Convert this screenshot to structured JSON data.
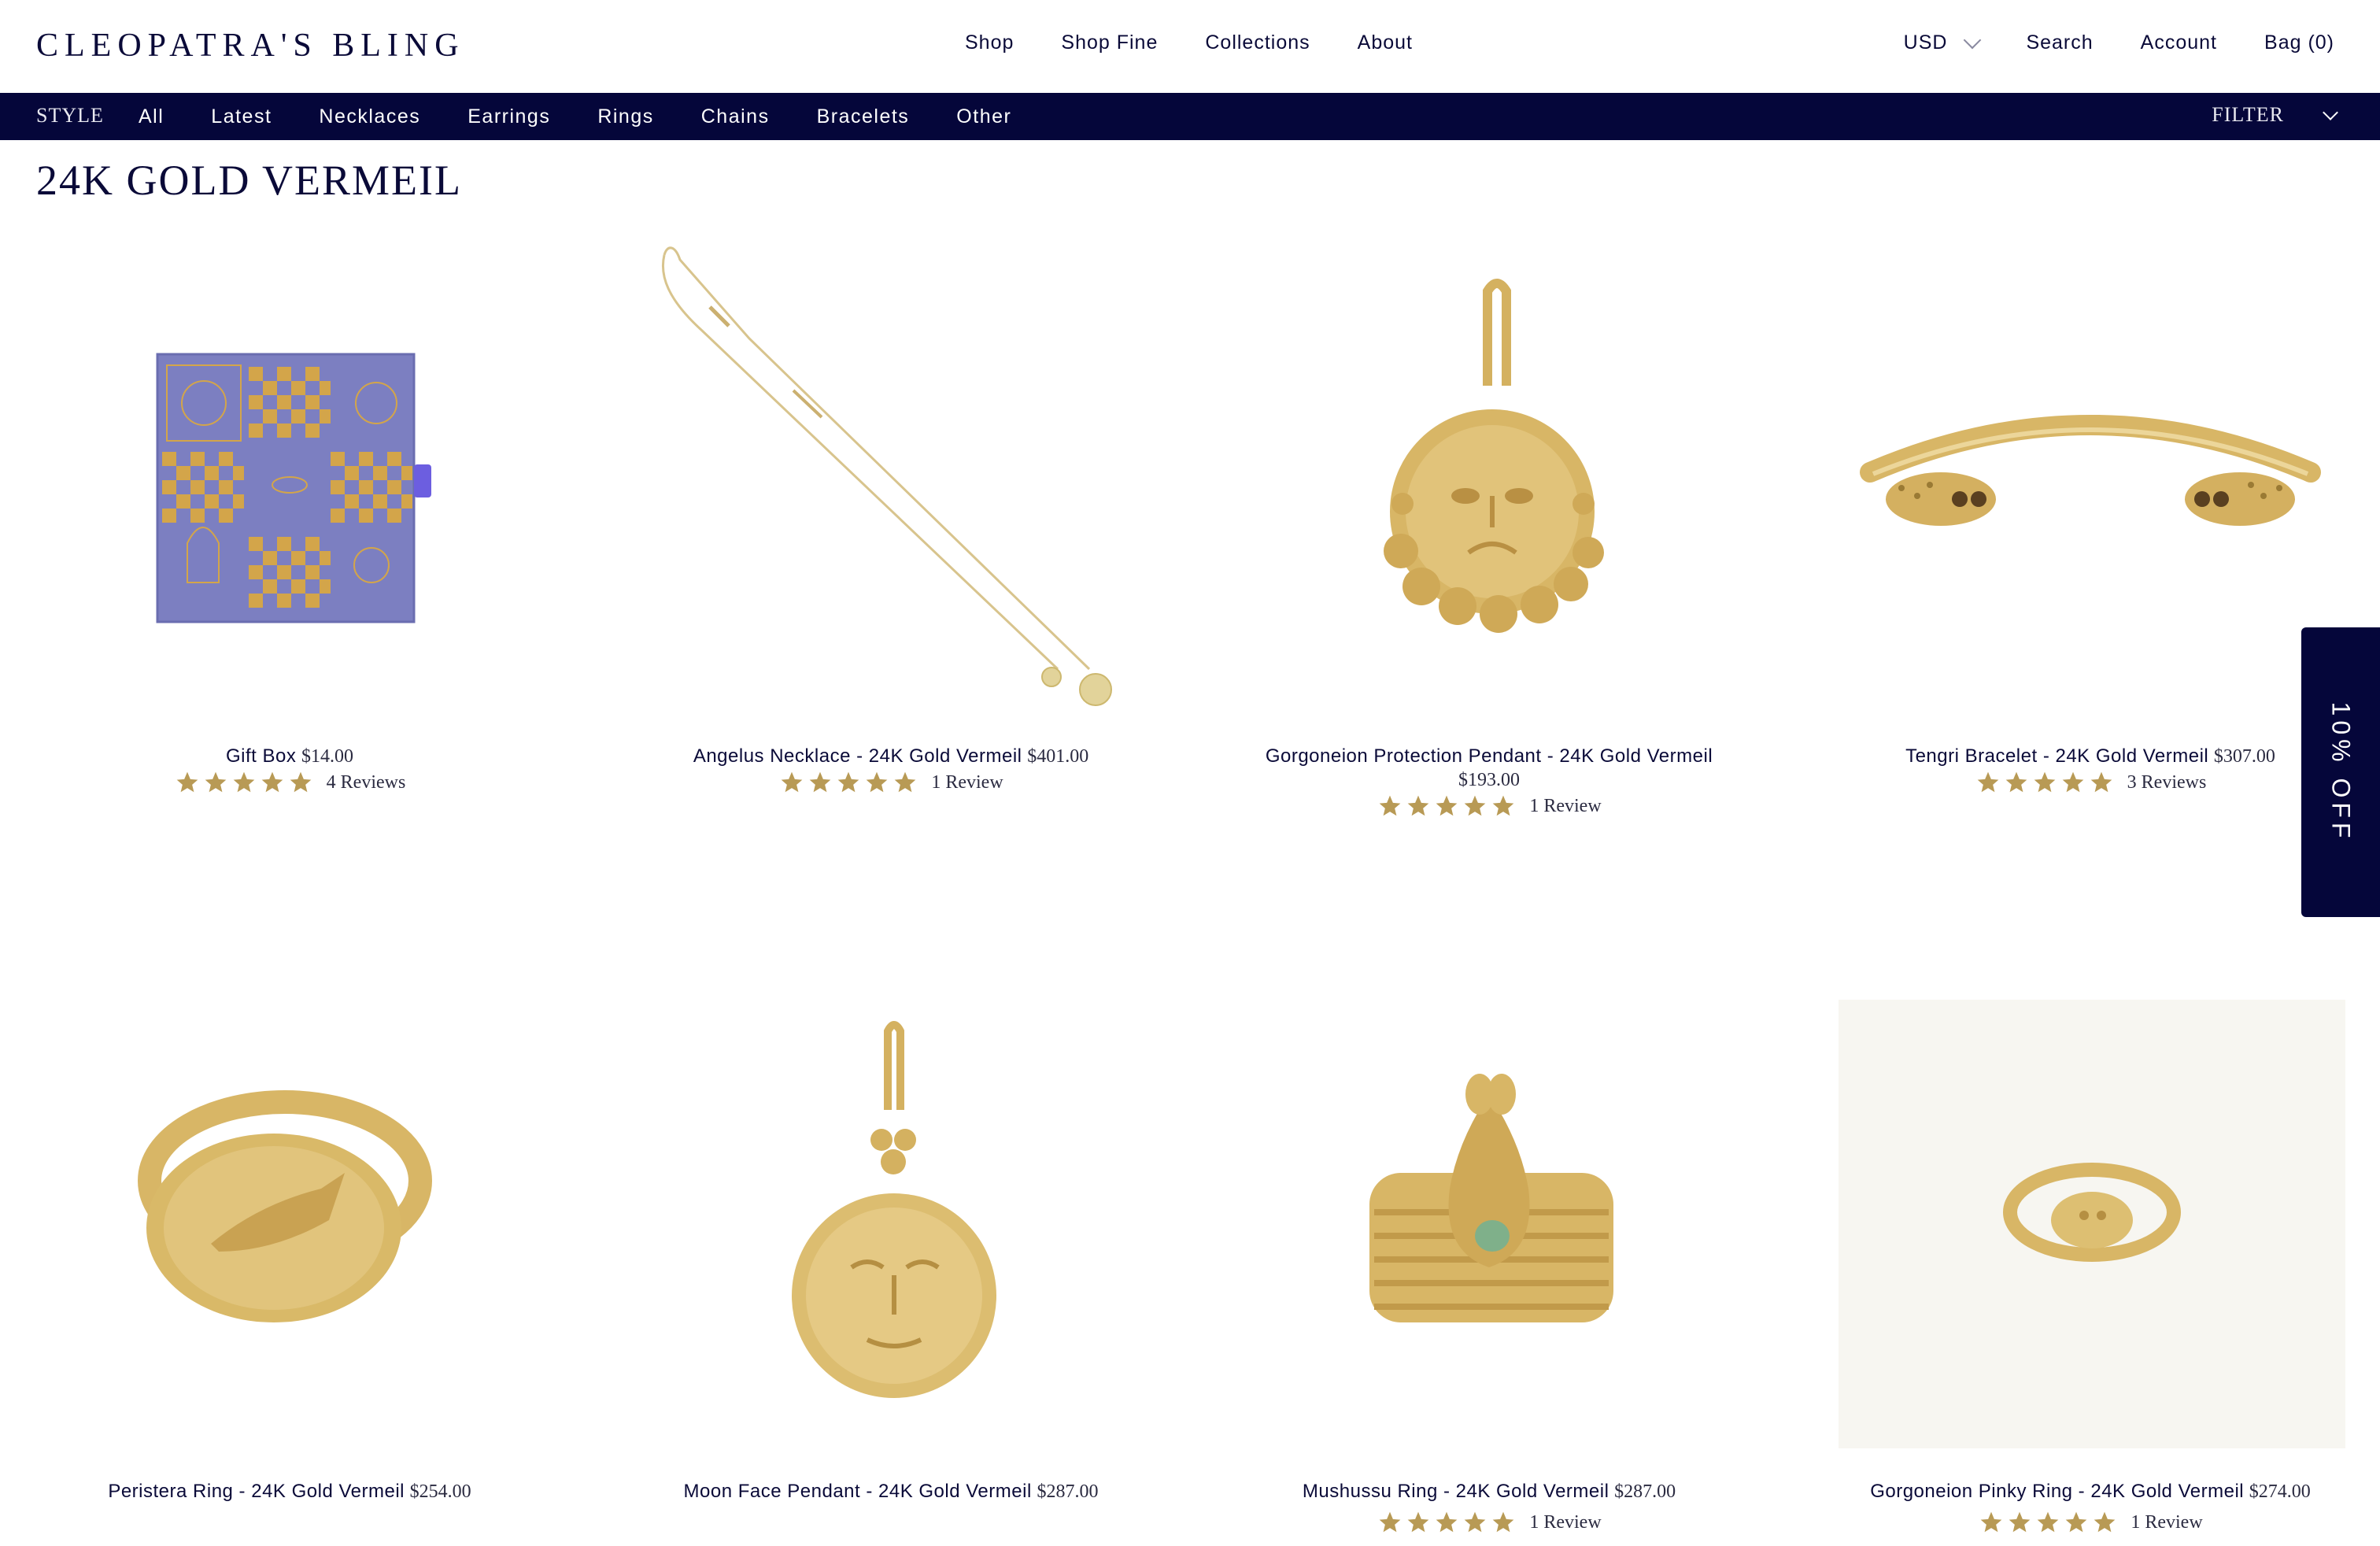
{
  "brand": {
    "logo_text": "CLEOPATRA'S BLING"
  },
  "main_nav": [
    "Shop",
    "Shop Fine",
    "Collections",
    "About"
  ],
  "utility_nav": {
    "currency": "USD",
    "search": "Search",
    "account": "Account",
    "bag": "Bag (0)"
  },
  "style_bar": {
    "label": "STYLE",
    "links": [
      "All",
      "Latest",
      "Necklaces",
      "Earrings",
      "Rings",
      "Chains",
      "Bracelets",
      "Other"
    ],
    "filter": "FILTER"
  },
  "page_title": "24K GOLD VERMEIL",
  "colors": {
    "navy": "#05063a",
    "star_gold": "#b89a55",
    "gold_product": "#d4b160",
    "box_lavender": "#7c7fc1"
  },
  "products": [
    {
      "name": "Gift Box",
      "price": "$14.00",
      "reviews": "4 Reviews",
      "stars": 5,
      "image_icon": "gift-box-image"
    },
    {
      "name": "Angelus Necklace - 24K Gold Vermeil",
      "price": "$401.00",
      "reviews": "1 Review",
      "stars": 5,
      "image_icon": "necklace-image"
    },
    {
      "name": "Gorgoneion Protection Pendant - 24K Gold Vermeil",
      "price": "$193.00",
      "reviews": "1 Review",
      "stars": 5,
      "image_icon": "pendant-image"
    },
    {
      "name": "Tengri Bracelet - 24K Gold Vermeil",
      "price": "$307.00",
      "reviews": "3 Reviews",
      "stars": 5,
      "image_icon": "bracelet-image"
    },
    {
      "name": "Peristera Ring - 24K Gold Vermeil",
      "price": "$254.00",
      "reviews": null,
      "stars": 0,
      "image_icon": "ring-image"
    },
    {
      "name": "Moon Face Pendant - 24K Gold Vermeil",
      "price": "$287.00",
      "reviews": null,
      "stars": 0,
      "image_icon": "moon-pendant-image"
    },
    {
      "name": "Mushussu Ring - 24K Gold Vermeil",
      "price": "$287.00",
      "reviews": "1 Review",
      "stars": 5,
      "image_icon": "serpent-ring-image"
    },
    {
      "name": "Gorgoneion Pinky Ring - 24K Gold Vermeil",
      "price": "$274.00",
      "reviews": "1 Review",
      "stars": 5,
      "image_icon": "pinky-ring-image"
    }
  ],
  "side_tab": {
    "label": "10% OFF"
  }
}
